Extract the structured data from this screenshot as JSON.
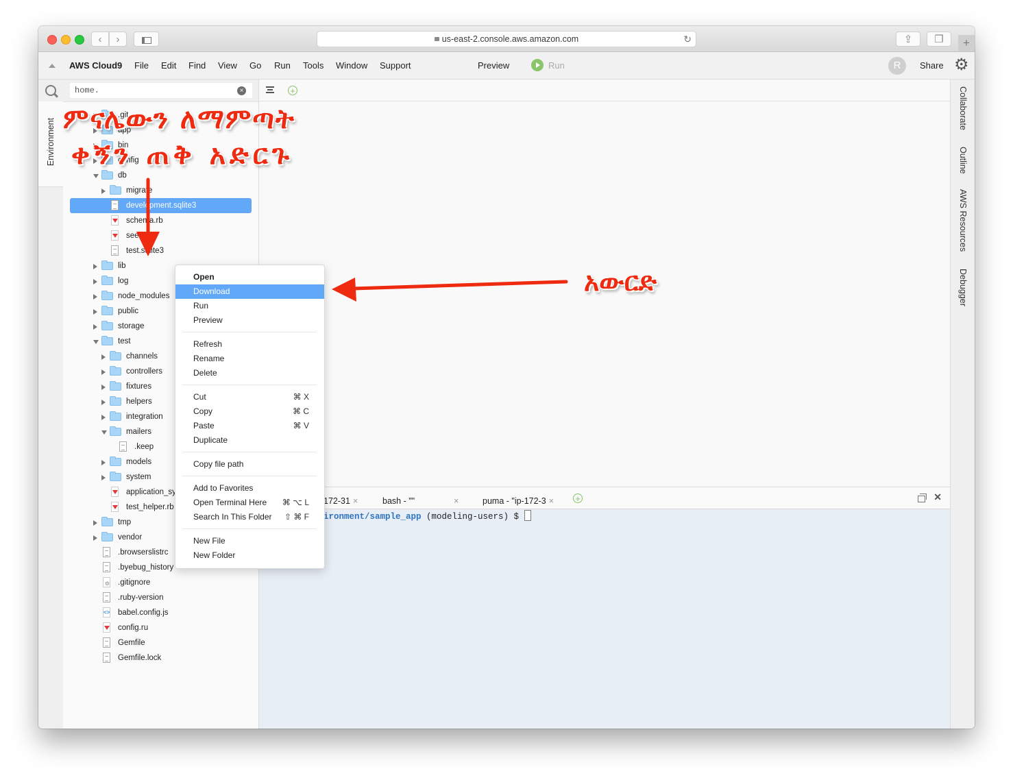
{
  "browser": {
    "url": "us-east-2.console.aws.amazon.com",
    "back_icon": "chevron-left",
    "forward_icon": "chevron-right",
    "sidebar_icon": "sidebar",
    "reload_icon": "reload",
    "share_icon": "share",
    "tabs_icon": "tabs",
    "new_tab": "+"
  },
  "menubar": {
    "brand": "AWS Cloud9",
    "items": [
      "File",
      "Edit",
      "Find",
      "View",
      "Go",
      "Run",
      "Tools",
      "Window",
      "Support"
    ],
    "preview": "Preview",
    "run": "Run",
    "avatar_initial": "R",
    "share": "Share"
  },
  "left_panel": {
    "env_tab": "Environment",
    "search_value": "home.",
    "clear_glyph": "×"
  },
  "tree": {
    "items": [
      {
        "name": ".git",
        "type": "folder",
        "depth": 0,
        "state": "collapsed"
      },
      {
        "name": "app",
        "type": "folder",
        "depth": 0,
        "state": "collapsed"
      },
      {
        "name": "bin",
        "type": "folder",
        "depth": 0,
        "state": "collapsed"
      },
      {
        "name": "config",
        "type": "folder",
        "depth": 0,
        "state": "collapsed"
      },
      {
        "name": "db",
        "type": "folder",
        "depth": 0,
        "state": "expanded"
      },
      {
        "name": "migrate",
        "type": "folder",
        "depth": 1,
        "state": "collapsed"
      },
      {
        "name": "development.sqlite3",
        "type": "file",
        "depth": 1,
        "selected": true
      },
      {
        "name": "schema.rb",
        "type": "ruby",
        "depth": 1
      },
      {
        "name": "seeds.rb",
        "type": "ruby",
        "depth": 1
      },
      {
        "name": "test.sqlite3",
        "type": "file",
        "depth": 1
      },
      {
        "name": "lib",
        "type": "folder",
        "depth": 0,
        "state": "collapsed"
      },
      {
        "name": "log",
        "type": "folder",
        "depth": 0,
        "state": "collapsed"
      },
      {
        "name": "node_modules",
        "type": "folder",
        "depth": 0,
        "state": "collapsed"
      },
      {
        "name": "public",
        "type": "folder",
        "depth": 0,
        "state": "collapsed"
      },
      {
        "name": "storage",
        "type": "folder",
        "depth": 0,
        "state": "collapsed"
      },
      {
        "name": "test",
        "type": "folder",
        "depth": 0,
        "state": "expanded"
      },
      {
        "name": "channels",
        "type": "folder",
        "depth": 1,
        "state": "collapsed"
      },
      {
        "name": "controllers",
        "type": "folder",
        "depth": 1,
        "state": "collapsed"
      },
      {
        "name": "fixtures",
        "type": "folder",
        "depth": 1,
        "state": "collapsed"
      },
      {
        "name": "helpers",
        "type": "folder",
        "depth": 1,
        "state": "collapsed"
      },
      {
        "name": "integration",
        "type": "folder",
        "depth": 1,
        "state": "collapsed"
      },
      {
        "name": "mailers",
        "type": "folder",
        "depth": 1,
        "state": "expanded"
      },
      {
        "name": ".keep",
        "type": "file",
        "depth": 2
      },
      {
        "name": "models",
        "type": "folder",
        "depth": 1,
        "state": "collapsed"
      },
      {
        "name": "system",
        "type": "folder",
        "depth": 1,
        "state": "collapsed"
      },
      {
        "name": "application_system_test_case.rb",
        "type": "ruby",
        "depth": 1
      },
      {
        "name": "test_helper.rb",
        "type": "ruby",
        "depth": 1
      },
      {
        "name": "tmp",
        "type": "folder",
        "depth": 0,
        "state": "collapsed"
      },
      {
        "name": "vendor",
        "type": "folder",
        "depth": 0,
        "state": "collapsed"
      },
      {
        "name": ".browserslistrc",
        "type": "file",
        "depth": 0
      },
      {
        "name": ".byebug_history",
        "type": "file",
        "depth": 0
      },
      {
        "name": ".gitignore",
        "type": "git",
        "depth": 0
      },
      {
        "name": ".ruby-version",
        "type": "file",
        "depth": 0
      },
      {
        "name": "babel.config.js",
        "type": "js",
        "depth": 0
      },
      {
        "name": "config.ru",
        "type": "ruby",
        "depth": 0
      },
      {
        "name": "Gemfile",
        "type": "file",
        "depth": 0
      },
      {
        "name": "Gemfile.lock",
        "type": "file",
        "depth": 0
      }
    ]
  },
  "context_menu": {
    "groups": [
      [
        {
          "label": "Open",
          "bold": true
        },
        {
          "label": "Download",
          "highlighted": true
        },
        {
          "label": "Run"
        },
        {
          "label": "Preview"
        }
      ],
      [
        {
          "label": "Refresh"
        },
        {
          "label": "Rename"
        },
        {
          "label": "Delete"
        }
      ],
      [
        {
          "label": "Cut",
          "shortcut": "⌘ X"
        },
        {
          "label": "Copy",
          "shortcut": "⌘ C"
        },
        {
          "label": "Paste",
          "shortcut": "⌘ V"
        },
        {
          "label": "Duplicate"
        }
      ],
      [
        {
          "label": "Copy file path"
        }
      ],
      [
        {
          "label": "Add to Favorites"
        },
        {
          "label": "Open Terminal Here",
          "shortcut": "⌘ ⌥ L"
        },
        {
          "label": "Search In This Folder",
          "shortcut": "⇧ ⌘ F"
        }
      ],
      [
        {
          "label": "New File"
        },
        {
          "label": "New Folder"
        }
      ]
    ]
  },
  "terminal": {
    "tabs": [
      {
        "label": "172-31",
        "close": "×"
      },
      {
        "label": "bash - \"\"",
        "close": "×"
      },
      {
        "label": "puma - \"ip-172-3",
        "close": "×"
      }
    ],
    "add_tab": "+",
    "prompt_path": "ironment/sample_app",
    "prompt_rest": " (modeling-users) $ ",
    "close_glyph": "✕"
  },
  "right_panel": {
    "tabs": [
      "Collaborate",
      "Outline",
      "AWS Resources",
      "Debugger"
    ]
  },
  "annotations": {
    "instruction_line1": "ምናሌውን ለማምጣት",
    "instruction_line2": "ቀኝን ጠቅ አድርጉ",
    "download_label": "አውርድ",
    "arrow_color": "#ee2a10"
  }
}
